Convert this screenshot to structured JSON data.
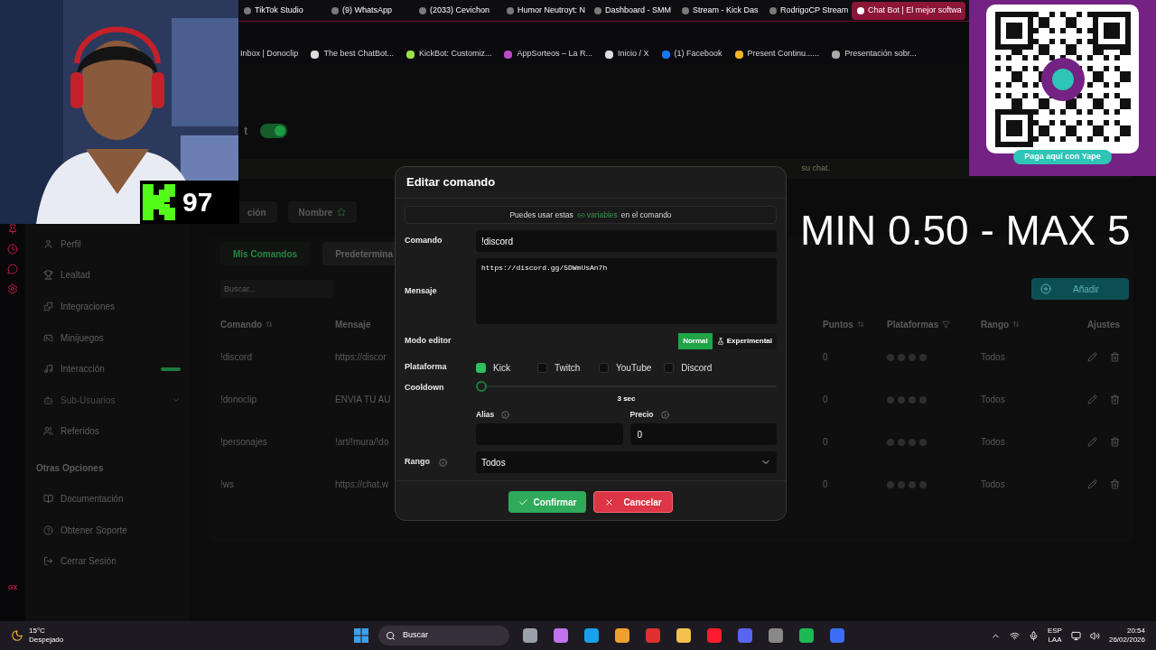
{
  "stream_overlay": {
    "follower_count": "97",
    "price_range": "MIN 0.50 - MAX 5",
    "qr_caption": "Paga aquí con Yape"
  },
  "browser": {
    "tabs": [
      {
        "label": "TikTok Studio",
        "selected": false
      },
      {
        "label": "(9) WhatsApp",
        "selected": false
      },
      {
        "label": "(2033) Cevichon",
        "selected": false
      },
      {
        "label": "Humor Neutroyt: N",
        "selected": false
      },
      {
        "label": "Dashboard - SMM",
        "selected": false
      },
      {
        "label": "Stream - Kick Das",
        "selected": false
      },
      {
        "label": "RodrigoCP Stream",
        "selected": false
      },
      {
        "label": "Chat Bot | El mejor softwa",
        "selected": true
      }
    ],
    "bookmarks": [
      "Inbox | Donoclip",
      "The best ChatBot...",
      "KickBot: Customiz...",
      "AppSorteos – La R...",
      "Inicio / X",
      "(1) Facebook",
      "Present Continu......",
      "Presentación sobr..."
    ]
  },
  "opera_sidebar": {
    "badge": "GX"
  },
  "page": {
    "header_fragment": "t",
    "toggle_on": true,
    "banner_fragment": "su chat.",
    "top_buttons": [
      "ción",
      "Nombre"
    ],
    "sidebar": {
      "items": [
        {
          "label": "Perfil",
          "disabled": false,
          "badge": false
        },
        {
          "label": "Lealtad",
          "disabled": false,
          "badge": false
        },
        {
          "label": "Integraciones",
          "disabled": false,
          "badge": false
        },
        {
          "label": "Minijuegos",
          "disabled": false,
          "badge": false
        },
        {
          "label": "Interacción",
          "disabled": false,
          "badge": true
        },
        {
          "label": "Sub-Usuarios",
          "disabled": true,
          "badge": false
        },
        {
          "label": "Referidos",
          "disabled": false,
          "badge": false
        }
      ],
      "section": "Otras Opciones",
      "more_items": [
        "Documentación",
        "Obtener Soporte",
        "Cerrar Sesión"
      ]
    },
    "tabs": [
      {
        "label": "Mis Comandos",
        "selected": true
      },
      {
        "label": "Predetermina",
        "selected": false
      }
    ],
    "search_placeholder": "Buscar...",
    "add_button": "Añadir",
    "table": {
      "columns": [
        "Comando",
        "Mensaje",
        "Puntos",
        "Plataformas",
        "Rango",
        "Ajustes"
      ],
      "rows": [
        {
          "command": "!discord",
          "message": "https://discor",
          "points": "0",
          "rank": "Todos"
        },
        {
          "command": "!donoclip",
          "message": "ENVIA TU AU",
          "points": "0",
          "rank": "Todos"
        },
        {
          "command": "!personajes",
          "message": "!art/!mura/!do",
          "points": "0",
          "rank": "Todos"
        },
        {
          "command": "!ws",
          "message": "https://chat.w",
          "points": "0",
          "rank": "Todos"
        }
      ]
    }
  },
  "dialog": {
    "title": "Editar comando",
    "hint_before": "Puedes usar estas",
    "hint_link": "variables",
    "hint_after": "en el comando",
    "command_label": "Comando",
    "command_value": "!discord",
    "message_label": "Mensaje",
    "message_value": "https://discord.gg/5DWmUsAn7h",
    "editor_label": "Modo editor",
    "editor_modes": [
      {
        "label": "Normal",
        "selected": true
      },
      {
        "label": "Experimental",
        "selected": false
      }
    ],
    "platform_label": "Plataforma",
    "platforms": [
      {
        "label": "Kick",
        "checked": true
      },
      {
        "label": "Twitch",
        "checked": false
      },
      {
        "label": "YouTube",
        "checked": false
      },
      {
        "label": "Discord",
        "checked": false
      }
    ],
    "cooldown_label": "Cooldown",
    "cooldown": {
      "level": 0,
      "reading": "3 sec"
    },
    "alias_label": "Alias",
    "price_label": "Precio",
    "price_value": "0",
    "rank_label": "Rango",
    "rank_value": "Todos",
    "confirm": "Confirmar",
    "cancel": "Cancelar"
  },
  "taskbar": {
    "temperature": "15°C",
    "weather": "Despejado",
    "search": "Buscar",
    "language": "ESP",
    "layout": "LAA",
    "time": "20:54",
    "date": "26/02/2026"
  }
}
